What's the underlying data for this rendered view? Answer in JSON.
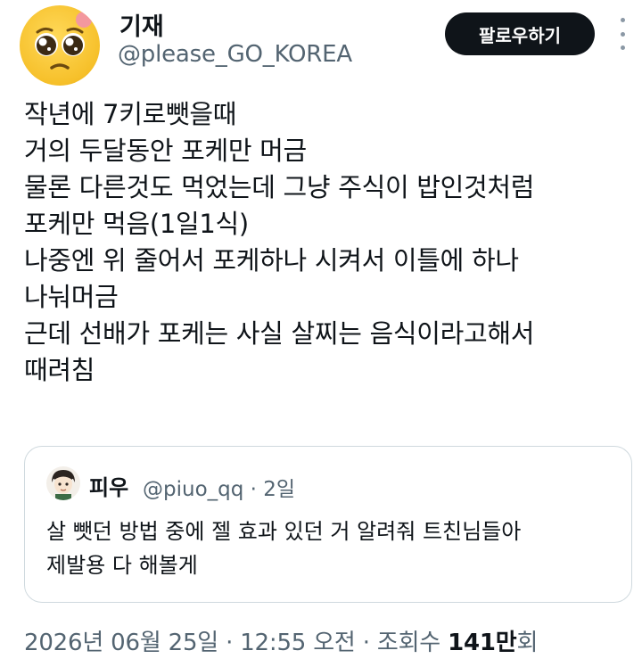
{
  "author": {
    "display_name": "기재",
    "handle": "@please_GO_KOREA",
    "avatar_icon": "pleading-face-emoji"
  },
  "follow_button_label": "팔로우하기",
  "more_icon": "vertical-ellipsis-icon",
  "tweet_text": "작년에 7키로뺏을때\n거의 두달동안 포케만 머금\n물론 다른것도 먹었는데 그냥 주식이 밥인것처럼\n포케만 먹음(1일1식)\n나중엔 위 줄어서 포케하나 시켜서 이틀에 하나\n나눠머금\n근데 선배가 포케는 사실 살찌는 음식이라고해서\n때려침",
  "quoted_tweet": {
    "display_name": "피우",
    "handle_time": "@piuo_qq · 2일",
    "text": "살 뺏던 방법 중에 젤 효과 있던 거 알려줘 트친님들아\n제발용 다 해볼게",
    "avatar_icon": "cartoon-character-avatar"
  },
  "meta": {
    "date_time": "2026년 06월 25일 · 12:55 오전 · 조회수 ",
    "views_count": "141만",
    "views_suffix": "회"
  }
}
